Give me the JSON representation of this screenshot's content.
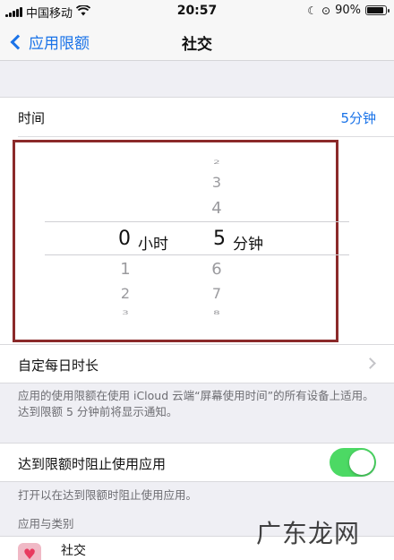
{
  "status_bar": {
    "carrier": "中国移动",
    "time": "20:57",
    "battery_percent": "90%",
    "battery_level": 0.9
  },
  "nav": {
    "back_label": "应用限额",
    "title": "社交"
  },
  "time_row": {
    "label": "时间",
    "value": "5分钟"
  },
  "picker": {
    "hours": {
      "above": [
        "2",
        "3",
        "4"
      ],
      "selected": "0",
      "unit": "小时",
      "below": [
        "1",
        "2",
        "3"
      ]
    },
    "minutes": {
      "above": [
        "2",
        "3",
        "4"
      ],
      "selected": "5",
      "unit": "分钟",
      "below": [
        "6",
        "7",
        "8"
      ]
    }
  },
  "custom_row": {
    "label": "自定每日时长"
  },
  "custom_footer": "应用的使用限额在使用 iCloud 云端“屏幕使用时间”的所有设备上适用。达到限额 5 分钟前将显示通知。",
  "block_row": {
    "label": "达到限额时阻止使用应用",
    "toggle_on": true
  },
  "block_footer": "打开以在达到限额时阻止使用应用。",
  "apps_header": "应用与类别",
  "app_item": {
    "label": "社交"
  },
  "watermark": "广东龙网",
  "colors": {
    "accent": "#1a73e8",
    "toggle_on": "#4cd964",
    "highlight_border": "#8b2a2a"
  }
}
